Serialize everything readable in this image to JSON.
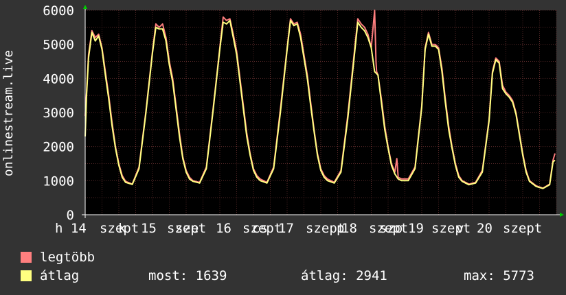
{
  "chart_data": {
    "type": "line",
    "ylabel": "onlinestream.live",
    "ylim": [
      0,
      6000
    ],
    "yticks": [
      0,
      1000,
      2000,
      3000,
      4000,
      5000,
      6000
    ],
    "xlim": [
      0,
      7
    ],
    "x_tick_labels": [
      "h 14",
      "szept",
      "15",
      "szept",
      "16",
      "szept",
      "17",
      "szept",
      "18",
      "szept",
      "19",
      "szept",
      "20",
      "szept",
      "k",
      "sze",
      "cs",
      "p",
      "szo",
      "v"
    ],
    "grid": true,
    "colors": {
      "background": "#333333",
      "plot": "#000000",
      "grid": "#5a2a2a",
      "axis": "#ffffff",
      "max": "#ff7f7f",
      "avg": "#ffff80"
    },
    "series": [
      {
        "name": "legtöbb",
        "color": "#ff7f7f",
        "x": [
          0,
          0.02,
          0.05,
          0.1,
          0.15,
          0.2,
          0.25,
          0.3,
          0.35,
          0.4,
          0.45,
          0.5,
          0.55,
          0.6,
          0.7,
          0.8,
          0.9,
          1,
          1.05,
          1.1,
          1.15,
          1.2,
          1.25,
          1.3,
          1.35,
          1.4,
          1.45,
          1.5,
          1.55,
          1.6,
          1.7,
          1.8,
          1.9,
          2,
          2.05,
          2.1,
          2.15,
          2.2,
          2.25,
          2.3,
          2.35,
          2.4,
          2.45,
          2.5,
          2.55,
          2.6,
          2.7,
          2.8,
          2.9,
          3,
          3.05,
          3.1,
          3.15,
          3.2,
          3.25,
          3.3,
          3.35,
          3.4,
          3.45,
          3.5,
          3.55,
          3.6,
          3.7,
          3.8,
          3.9,
          4,
          4.05,
          4.1,
          4.15,
          4.2,
          4.25,
          4.3,
          4.32,
          4.33,
          4.35,
          4.4,
          4.45,
          4.5,
          4.55,
          4.6,
          4.63,
          4.65,
          4.7,
          4.8,
          4.9,
          5,
          5.05,
          5.1,
          5.15,
          5.2,
          5.25,
          5.3,
          5.35,
          5.4,
          5.45,
          5.5,
          5.55,
          5.6,
          5.7,
          5.8,
          5.9,
          6,
          6.05,
          6.1,
          6.15,
          6.2,
          6.25,
          6.3,
          6.35,
          6.4,
          6.45,
          6.5,
          6.55,
          6.6,
          6.7,
          6.8,
          6.9,
          6.95,
          6.98
        ],
        "values": [
          2900,
          3600,
          4700,
          5400,
          5200,
          5300,
          4900,
          4200,
          3500,
          2700,
          2000,
          1500,
          1150,
          980,
          900,
          1400,
          3000,
          4800,
          5600,
          5500,
          5600,
          5200,
          4500,
          4000,
          3200,
          2400,
          1700,
          1300,
          1100,
          1000,
          950,
          1400,
          3100,
          4900,
          5800,
          5700,
          5750,
          5300,
          4800,
          4000,
          3200,
          2400,
          1800,
          1350,
          1150,
          1050,
          950,
          1400,
          3100,
          4900,
          5750,
          5600,
          5650,
          5300,
          4700,
          4100,
          3300,
          2500,
          1800,
          1350,
          1150,
          1050,
          950,
          1300,
          2900,
          4800,
          5750,
          5600,
          5500,
          5300,
          4900,
          6000,
          4500,
          4200,
          4100,
          3400,
          2600,
          2000,
          1500,
          1250,
          1650,
          1100,
          1050,
          1050,
          1400,
          3200,
          4900,
          5350,
          5000,
          5000,
          4900,
          4300,
          3400,
          2600,
          2000,
          1500,
          1150,
          1000,
          900,
          950,
          1300,
          2800,
          4200,
          4600,
          4500,
          3800,
          3600,
          3500,
          3350,
          3000,
          2400,
          1800,
          1300,
          1000,
          850,
          780,
          900,
          1600,
          1800
        ]
      },
      {
        "name": "átlag",
        "color": "#ffff80",
        "x": [
          0,
          0.02,
          0.05,
          0.1,
          0.15,
          0.2,
          0.25,
          0.3,
          0.35,
          0.4,
          0.45,
          0.5,
          0.55,
          0.6,
          0.7,
          0.8,
          0.9,
          1,
          1.05,
          1.1,
          1.15,
          1.2,
          1.25,
          1.3,
          1.35,
          1.4,
          1.45,
          1.5,
          1.55,
          1.6,
          1.7,
          1.8,
          1.9,
          2,
          2.05,
          2.1,
          2.15,
          2.2,
          2.25,
          2.3,
          2.35,
          2.4,
          2.45,
          2.5,
          2.55,
          2.6,
          2.7,
          2.8,
          2.9,
          3,
          3.05,
          3.1,
          3.15,
          3.2,
          3.25,
          3.3,
          3.35,
          3.4,
          3.45,
          3.5,
          3.55,
          3.6,
          3.7,
          3.8,
          3.9,
          4,
          4.05,
          4.1,
          4.15,
          4.2,
          4.25,
          4.3,
          4.35,
          4.4,
          4.45,
          4.5,
          4.55,
          4.6,
          4.65,
          4.7,
          4.8,
          4.9,
          5,
          5.05,
          5.1,
          5.15,
          5.2,
          5.25,
          5.3,
          5.35,
          5.4,
          5.45,
          5.5,
          5.55,
          5.6,
          5.7,
          5.8,
          5.9,
          6,
          6.05,
          6.1,
          6.15,
          6.2,
          6.25,
          6.3,
          6.35,
          6.4,
          6.45,
          6.5,
          6.55,
          6.6,
          6.7,
          6.8,
          6.9,
          6.95,
          6.98
        ],
        "values": [
          2300,
          3500,
          4600,
          5350,
          5100,
          5250,
          4850,
          4100,
          3400,
          2600,
          1950,
          1450,
          1100,
          950,
          890,
          1350,
          2950,
          4750,
          5500,
          5450,
          5450,
          5100,
          4400,
          3900,
          3100,
          2300,
          1650,
          1250,
          1050,
          980,
          930,
          1350,
          3050,
          4850,
          5650,
          5600,
          5700,
          5200,
          4700,
          3900,
          3100,
          2300,
          1750,
          1300,
          1100,
          1000,
          930,
          1350,
          3000,
          4850,
          5700,
          5550,
          5600,
          5200,
          4600,
          4000,
          3200,
          2450,
          1750,
          1300,
          1100,
          1000,
          930,
          1250,
          2800,
          4700,
          5650,
          5500,
          5400,
          5200,
          4900,
          4200,
          4100,
          3300,
          2500,
          1950,
          1450,
          1200,
          1050,
          1000,
          1000,
          1350,
          3150,
          4850,
          5300,
          4950,
          4950,
          4850,
          4200,
          3300,
          2500,
          1950,
          1450,
          1100,
          980,
          880,
          930,
          1250,
          2750,
          4150,
          4550,
          4450,
          3700,
          3550,
          3450,
          3300,
          2950,
          2350,
          1750,
          1250,
          980,
          830,
          770,
          880,
          1550,
          1600
        ]
      }
    ]
  },
  "legend": [
    {
      "label": "legtöbb",
      "color": "#ff7f7f"
    },
    {
      "label": "átlag",
      "color": "#ffff80"
    }
  ],
  "stats": {
    "now": "most: 1639",
    "avg": "átlag: 2941",
    "max": "max: 5773"
  }
}
